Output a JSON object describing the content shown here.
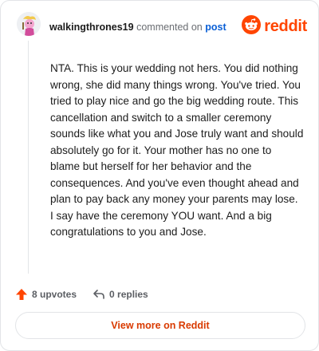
{
  "header": {
    "username": "walkingthrones19",
    "action_text": "commented on",
    "post_link": "post",
    "brand": "reddit"
  },
  "comment": {
    "body": "NTA. This is your wedding not hers. You did nothing wrong, she did many things wrong. You've tried. You tried to play nice and go the big wedding route. This cancellation and switch to a smaller ceremony sounds like what you and Jose truly want and should absolutely go for it. Your mother has no one to blame but herself for her behavior and the consequences. And you've even thought ahead and plan to pay back any money your parents may lose. I say have the ceremony YOU want. And a big congratulations to you and Jose."
  },
  "actions": {
    "upvotes": "8 upvotes",
    "replies": "0 replies"
  },
  "cta": {
    "label": "View more on Reddit"
  },
  "colors": {
    "brand": "#ff4500",
    "link": "#0a5fd6",
    "cta_text": "#d93a00",
    "upvote": "#ff4500"
  },
  "icons": [
    "avatar",
    "reddit-logo-icon",
    "upvote-arrow-icon",
    "reply-arrow-icon"
  ]
}
